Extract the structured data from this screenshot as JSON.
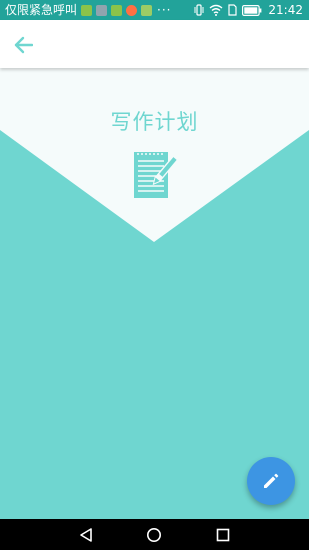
{
  "status_bar": {
    "carrier_text": "仅限紧急呼叫",
    "more_indicator": "···",
    "time": "21:42",
    "notification_app_colors": [
      "#8bc34a",
      "#90a4ae",
      "#8bc34a",
      "#ff7043",
      "#9ccc65"
    ],
    "icons": [
      "vibrate-icon",
      "wifi-icon",
      "sim-icon",
      "battery-icon"
    ]
  },
  "toolbar": {
    "back_icon": "arrow-left-icon"
  },
  "hero": {
    "title": "写作计划",
    "icon": "notepad-pen-icon"
  },
  "fab": {
    "icon": "pencil-icon",
    "color": "#3d95e3"
  },
  "nav_bar": {
    "buttons": [
      "back-triangle-icon",
      "home-circle-icon",
      "recents-square-icon"
    ]
  },
  "colors": {
    "accent": "#6fd6d0",
    "status_bar": "#22a39a",
    "fab": "#3d95e3"
  }
}
